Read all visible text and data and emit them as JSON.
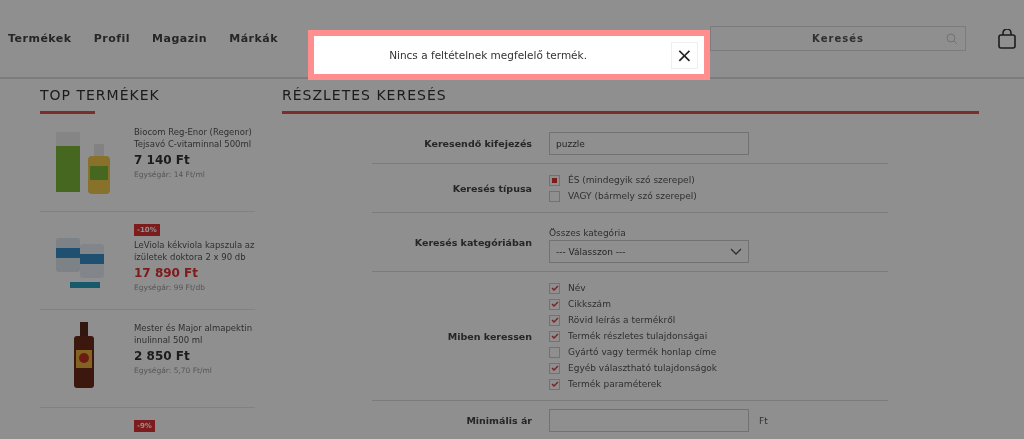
{
  "nav": [
    "Termékek",
    "Profil",
    "Magazin",
    "Márkák"
  ],
  "search": {
    "placeholder": "Keresés"
  },
  "modal": {
    "message": "Nincs a feltételnek megfelelő termék.",
    "close": "×"
  },
  "top_products": {
    "title": "TOP TERMÉKEK",
    "items": [
      {
        "kind": "picture",
        "name": "Biocom Reg-Enor (Regenor) Tejsavó C-vitaminnal 500ml",
        "price": "7 140 Ft",
        "unit_price": "Egységár: 14 Ft/ml",
        "sale": false
      },
      {
        "kind": "picture",
        "badge": "-10%",
        "name": "LeViola kékviola kapszula az ízületek doktora 2 x 90 db",
        "price": "17 890 Ft",
        "unit_price": "Egységár: 99 Ft/db",
        "sale": true
      },
      {
        "kind": "picture",
        "name": "Mester és Major almapektin inulinnal 500 ml",
        "price": "2 850 Ft",
        "unit_price": "Egységár: 5,70 Ft/ml",
        "sale": false
      },
      {
        "badge": "-9%"
      }
    ]
  },
  "search_form": {
    "title": "RÉSZLETES KERESÉS",
    "rows": [
      {
        "kind": "text",
        "label": "Keresendő kifejezés",
        "value": "puzzle"
      },
      {
        "kind": "radio",
        "label": "Keresés típusa",
        "options": [
          {
            "label": "ÉS (mindegyik szó szerepel)",
            "selected": true
          },
          {
            "label": "VAGY (bármely szó szerepel)",
            "selected": false
          }
        ]
      },
      {
        "kind": "select",
        "label": "Keresés kategóriában",
        "caption": "Összes kategória",
        "value": "--- Válasszon ---"
      },
      {
        "kind": "checks",
        "label": "Miben keressen",
        "options": [
          {
            "label": "Név",
            "checked": true
          },
          {
            "label": "Cikkszám",
            "checked": true
          },
          {
            "label": "Rövid leírás a termékről",
            "checked": true
          },
          {
            "label": "Termék részletes tulajdonságai",
            "checked": true
          },
          {
            "label": "Gyártó vagy termék honlap címe",
            "checked": false
          },
          {
            "label": "Egyéb választható tulajdonságok",
            "checked": true
          },
          {
            "label": "Termék paraméterek",
            "checked": true
          }
        ]
      },
      {
        "kind": "price",
        "label": "Minimális ár",
        "unit": "Ft"
      }
    ]
  }
}
